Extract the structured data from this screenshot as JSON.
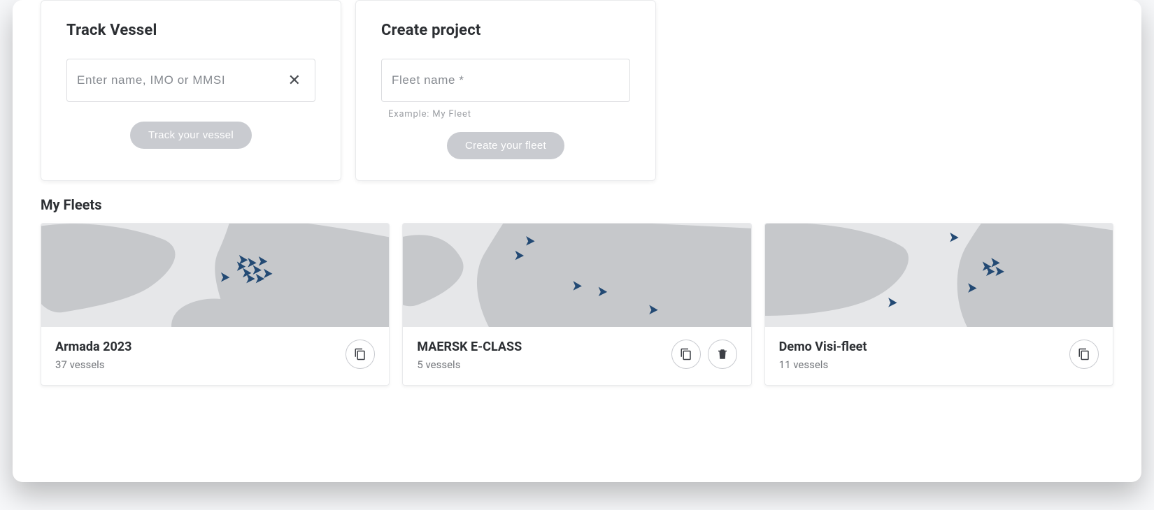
{
  "colors": {
    "accent_vessel": "#234a74",
    "landmass": "#c6c8cb",
    "sea": "#e6e7e9"
  },
  "track_vessel": {
    "title": "Track Vessel",
    "placeholder": "Enter name, IMO or MMSI",
    "button": "Track your vessel"
  },
  "create_project": {
    "title": "Create project",
    "placeholder": "Fleet name *",
    "helper": "Example: My Fleet",
    "button": "Create your fleet"
  },
  "my_fleets": {
    "title": "My Fleets",
    "items": [
      {
        "name": "Armada 2023",
        "count_label": "37 vessels",
        "actions": [
          "copy"
        ]
      },
      {
        "name": "MAERSK E-CLASS",
        "count_label": "5 vessels",
        "actions": [
          "copy",
          "delete"
        ]
      },
      {
        "name": "Demo Visi-fleet",
        "count_label": "11 vessels",
        "actions": [
          "copy"
        ]
      }
    ]
  }
}
